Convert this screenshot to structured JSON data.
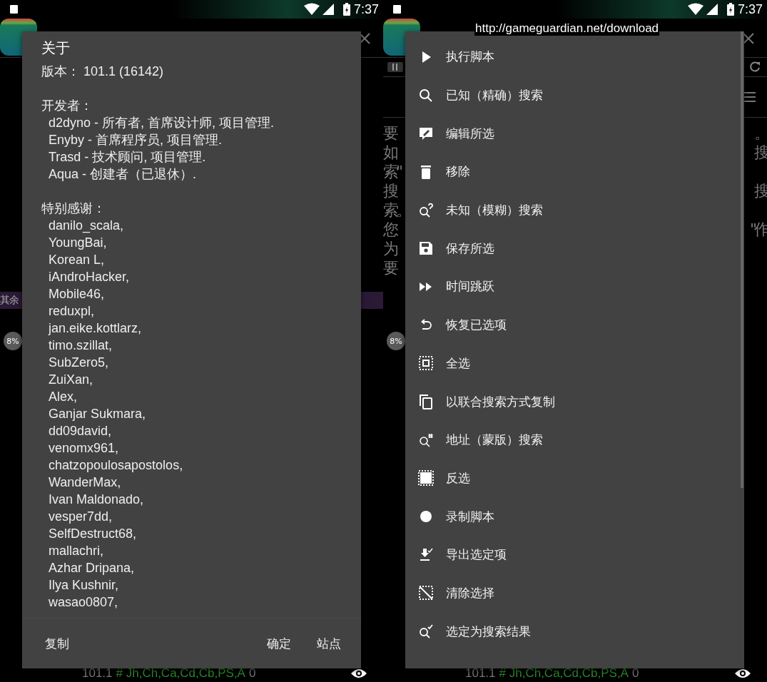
{
  "left_screen": {
    "status_bar": {
      "time": "7:37"
    },
    "background": {
      "side_label": "其余",
      "badge": "8%",
      "footer": {
        "version": "101.1",
        "hash": "#",
        "flags": "Jh,Ch,Ca,Cd,Cb,PS,A",
        "count": "0"
      }
    },
    "dialog": {
      "title": "关于",
      "version": "版本： 101.1 (16142)",
      "developers_heading": "开发者：",
      "developers": [
        "d2dyno - 所有者, 首席设计师, 项目管理.",
        "Enyby - 首席程序员, 项目管理.",
        "Trasd - 技术顾问, 项目管理.",
        "Aqua - 创建者（已退休）."
      ],
      "thanks_heading": "特别感谢：",
      "thanks": [
        "danilo_scala,",
        "YoungBai,",
        "Korean L,",
        "iAndroHacker,",
        "Mobile46,",
        "reduxpl,",
        "jan.eike.kottlarz,",
        "timo.szillat,",
        "SubZero5,",
        "ZuiXan,",
        "Alex,",
        "Ganjar Sukmara,",
        "dd09david,",
        "venomx961,",
        "chatzopoulosapostolos,",
        "WanderMax,",
        "Ivan Maldonado,",
        "vesper7dd,",
        "SelfDestruct68,",
        "mallachri,",
        "Azhar Dripana,",
        "Ilya Kushnir,",
        "wasao0807,"
      ],
      "buttons": [
        {
          "label": "复制"
        },
        {
          "label": "确定"
        },
        {
          "label": "站点"
        }
      ]
    }
  },
  "right_screen": {
    "status_bar": {
      "time": "7:37"
    },
    "tooltip": "http://gameguardian.net/download",
    "background": {
      "rows": [
        {
          "left": "要",
          "right": "。"
        },
        {
          "left": "如",
          "right": "搜"
        },
        {
          "left": "索\""
        },
        {
          "left": "搜",
          "right": "搜"
        },
        {
          "left": "索。"
        },
        {
          "left": "您",
          "right": "\"作"
        },
        {
          "left": "为"
        },
        {
          "left": "要"
        }
      ],
      "badge": "8%",
      "footer": {
        "version": "101.1",
        "hash": "#",
        "flags": "Jh,Ch,Ca,Cd,Cb,PS,A",
        "count": "0"
      }
    },
    "menu": [
      {
        "kind": "play",
        "label": "执行脚本"
      },
      {
        "kind": "search",
        "label": "已知（精确）搜索"
      },
      {
        "kind": "edit",
        "label": "编辑所选"
      },
      {
        "kind": "trash",
        "label": "移除"
      },
      {
        "kind": "search-unknown",
        "label": "未知（模糊）搜索"
      },
      {
        "kind": "save",
        "label": "保存所选"
      },
      {
        "kind": "fast-forward",
        "label": "时间跳跃"
      },
      {
        "kind": "undo",
        "label": "恢复已选项"
      },
      {
        "kind": "select-all",
        "label": "全选"
      },
      {
        "kind": "copy",
        "label": "以联合搜索方式复制"
      },
      {
        "kind": "search-address",
        "label": "地址（蒙版）搜索"
      },
      {
        "kind": "invert",
        "label": "反选"
      },
      {
        "kind": "record",
        "label": "录制脚本"
      },
      {
        "kind": "export",
        "label": "导出选定项"
      },
      {
        "kind": "clear",
        "label": "清除选择"
      },
      {
        "kind": "search-select",
        "label": "选定为搜索结果"
      }
    ]
  }
}
